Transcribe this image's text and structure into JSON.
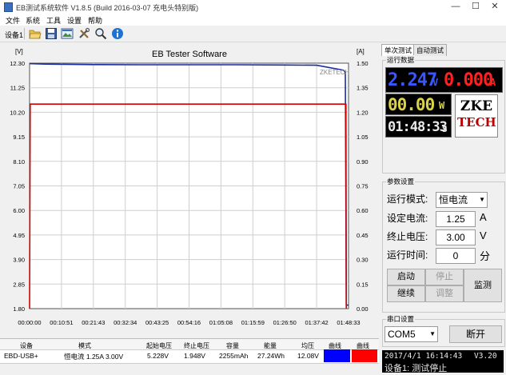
{
  "window": {
    "title": "EB测试系统软件 V1.8.5 (Build 2016-03-07 充电头特别版)",
    "minimize": "—",
    "maximize": "☐",
    "close": "✕"
  },
  "menu": [
    "文件",
    "系统",
    "工具",
    "设置",
    "帮助"
  ],
  "toolbar": {
    "device_label": "设备1",
    "icons": [
      "folder-open-icon",
      "save-icon",
      "image-icon",
      "tools-icon",
      "zoom-icon",
      "info-icon"
    ]
  },
  "chart_data": {
    "type": "line",
    "title": "EB Tester Software",
    "left_unit": "[V]",
    "right_unit": "[A]",
    "watermark": "ZKETECH",
    "y_left_ticks": [
      "12.30",
      "11.25",
      "10.20",
      "9.15",
      "8.10",
      "7.05",
      "6.00",
      "4.95",
      "3.90",
      "2.85",
      "1.80"
    ],
    "y_right_ticks": [
      "1.50",
      "1.35",
      "1.20",
      "1.05",
      "0.90",
      "0.75",
      "0.60",
      "0.45",
      "0.30",
      "0.15",
      "0.00"
    ],
    "x_ticks": [
      "00:00:00",
      "00:10:51",
      "00:21:43",
      "00:32:34",
      "00:43:25",
      "00:54:16",
      "01:05:08",
      "01:15:59",
      "01:26:50",
      "01:37:42",
      "01:48:33"
    ],
    "ylim_left": [
      1.8,
      12.3
    ],
    "ylim_right": [
      0,
      1.5
    ],
    "grid": true,
    "series": [
      {
        "axis": "left",
        "color": "#1a2ea0",
        "points": [
          [
            0,
            12.28
          ],
          [
            0.05,
            12.26
          ],
          [
            0.2,
            12.24
          ],
          [
            0.35,
            12.23
          ],
          [
            0.5,
            12.23
          ],
          [
            0.65,
            12.23
          ],
          [
            0.8,
            12.22
          ],
          [
            0.9,
            12.21
          ],
          [
            0.985,
            12.0
          ],
          [
            0.99,
            11.9
          ],
          [
            0.993,
            1.95
          ],
          [
            1.0,
            1.95
          ]
        ]
      },
      {
        "axis": "right",
        "color": "#d40000",
        "points": [
          [
            0,
            0.0
          ],
          [
            0.002,
            1.25
          ],
          [
            0.5,
            1.25
          ],
          [
            0.992,
            1.25
          ],
          [
            0.993,
            0.0
          ]
        ]
      }
    ]
  },
  "tabs": [
    "单次测试",
    "自动测试"
  ],
  "run_data": {
    "group_title": "运行数据",
    "voltage": "2.247",
    "voltage_unit": "V",
    "current": "0.000",
    "current_unit": "A",
    "power": "00.00",
    "power_unit": "W",
    "time": "01:48:33",
    "time_unit": "S",
    "logo_top": "ZKE",
    "logo_bottom": "TECH"
  },
  "params": {
    "group_title": "参数设置",
    "mode_label": "运行模式:",
    "mode_value": "恒电流",
    "set_current_label": "设定电流:",
    "set_current_value": "1.25",
    "set_current_unit": "A",
    "cutoff_label": "终止电压:",
    "cutoff_value": "3.00",
    "cutoff_unit": "V",
    "runtime_label": "运行时间:",
    "runtime_value": "0",
    "runtime_unit": "分"
  },
  "buttons": {
    "start": "启动",
    "stop": "停止",
    "continue": "继续",
    "adjust": "调整",
    "monitor": "监测"
  },
  "serial": {
    "group_title": "串口设置",
    "port": "COM5",
    "disconnect": "断开"
  },
  "status_lcd": {
    "datetime": "2017/4/1 16:14:43",
    "version": "V3.20",
    "message": "设备1: 测试停止"
  },
  "table": {
    "headers": [
      "设备",
      "模式",
      "起始电压",
      "终止电压",
      "容量",
      "能量",
      "均压",
      "曲线",
      "曲线"
    ],
    "row": [
      "EBD-USB+",
      "恒电流  1.25A  3.00V",
      "5.228V",
      "1.948V",
      "2255mAh",
      "27.24Wh",
      "12.08V"
    ],
    "curve_colors": [
      "#0000ff",
      "#ff0000"
    ]
  }
}
